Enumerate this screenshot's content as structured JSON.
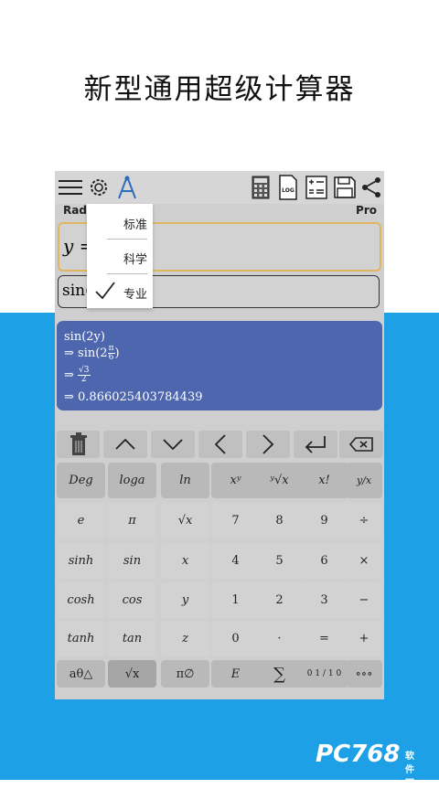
{
  "headline": "新型通用超级计算器",
  "toolbar": {
    "icons": [
      "menu-icon",
      "settings-icon",
      "compass-icon",
      "calculator-icon",
      "log-icon",
      "list-icon",
      "save-icon",
      "share-icon"
    ],
    "log_label": "LOG"
  },
  "mode": {
    "left": "Rad",
    "right": "Pro"
  },
  "input1": {
    "expression": "y ="
  },
  "input2": {
    "expression": "sin("
  },
  "menu": {
    "items": [
      {
        "label": "标准",
        "checked": false
      },
      {
        "label": "科学",
        "checked": false
      },
      {
        "label": "专业",
        "checked": true
      }
    ]
  },
  "result": {
    "line1": "sin(2y)",
    "line2_prefix": "⇒ sin(2",
    "line2_num": "π",
    "line2_den": "6",
    "line2_suffix": ")",
    "line3_prefix": "⇒",
    "line3_num": "√3",
    "line3_den": "2",
    "line4": "⇒ 0.866025403784439"
  },
  "nav_keys": [
    "delete",
    "up",
    "down",
    "left",
    "right",
    "enter",
    "backspace"
  ],
  "keypad": {
    "rows": [
      [
        "Deg",
        "loga",
        "ln",
        "xʸ",
        "ʸ√x",
        "x!",
        "y/x"
      ],
      [
        "e",
        "π",
        "√x",
        "7",
        "8",
        "9",
        "÷"
      ],
      [
        "sinh",
        "sin",
        "x",
        "4",
        "5",
        "6",
        "×"
      ],
      [
        "cosh",
        "cos",
        "y",
        "1",
        "2",
        "3",
        "−"
      ],
      [
        "tanh",
        "tan",
        "z",
        "0",
        "·",
        "=",
        "+"
      ]
    ],
    "bottom": [
      "aθ△",
      "√x",
      "π∅",
      "E",
      "∑",
      "0 1 / 1 0",
      "∘∘∘"
    ]
  },
  "watermark": {
    "brand": "PC768",
    "sub": "软件园"
  }
}
